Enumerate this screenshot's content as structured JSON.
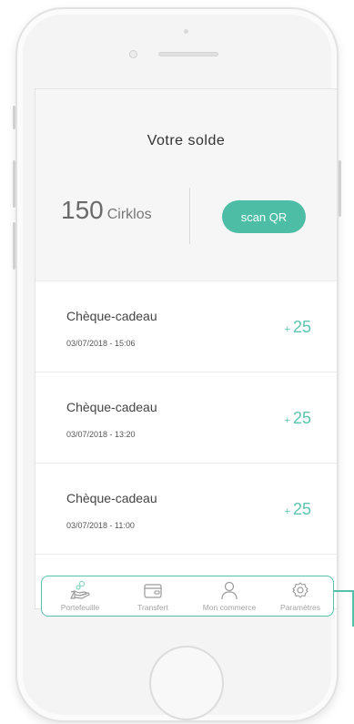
{
  "balance": {
    "title": "Votre solde",
    "amount": "150",
    "unit": "Cirklos",
    "scan_label": "scan QR"
  },
  "transactions": [
    {
      "title": "Chèque-cadeau",
      "date": "03/07/2018 - 15:06",
      "sign": "+",
      "amount": "25"
    },
    {
      "title": "Chèque-cadeau",
      "date": "03/07/2018 - 13:20",
      "sign": "+",
      "amount": "25"
    },
    {
      "title": "Chèque-cadeau",
      "date": "03/07/2018 - 11:00",
      "sign": "+",
      "amount": "25"
    }
  ],
  "nav": {
    "items": [
      {
        "label": "Portefeuille",
        "icon": "wallet-hand-icon"
      },
      {
        "label": "Transfert",
        "icon": "card-wallet-icon"
      },
      {
        "label": "Mon commerce",
        "icon": "user-icon"
      },
      {
        "label": "Paramètres",
        "icon": "gear-icon"
      }
    ]
  },
  "colors": {
    "accent": "#4dbda6",
    "amount_text": "#5cc4b0",
    "nav_outline": "#55c1ac",
    "nav_label": "#a3a3a3"
  }
}
